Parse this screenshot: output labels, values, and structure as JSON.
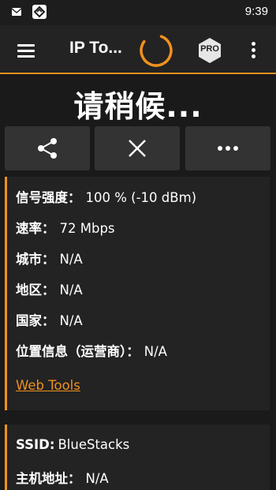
{
  "status_bar": {
    "time": "9:39",
    "icons": [
      "mail-icon",
      "app-notification-icon"
    ]
  },
  "app_bar": {
    "title": "IP To...",
    "pro_label": "PRO",
    "accent_color": "#f0911e",
    "icons": [
      "hamburger-menu-icon",
      "loading-spinner-icon",
      "pro-badge-icon",
      "more-vert-icon"
    ]
  },
  "heading": "请稍候...",
  "actions": [
    {
      "name": "share",
      "icon": "share-icon"
    },
    {
      "name": "close",
      "icon": "close-icon"
    },
    {
      "name": "more",
      "icon": "more-horiz-icon"
    }
  ],
  "info_card": {
    "rows": [
      {
        "label": "信号强度：",
        "value": "100 % (-10 dBm)"
      },
      {
        "label": "速率：",
        "value": "72 Mbps"
      },
      {
        "label": "城市：",
        "value": "N/A"
      },
      {
        "label": "地区：",
        "value": "N/A"
      },
      {
        "label": "国家：",
        "value": "N/A"
      },
      {
        "label": "位置信息（运营商）：",
        "value": "N/A"
      }
    ],
    "link": "Web Tools"
  },
  "network_card": {
    "rows": [
      {
        "label": "SSID:",
        "value": "BlueStacks"
      },
      {
        "label": "主机地址：",
        "value": "N/A"
      }
    ]
  }
}
